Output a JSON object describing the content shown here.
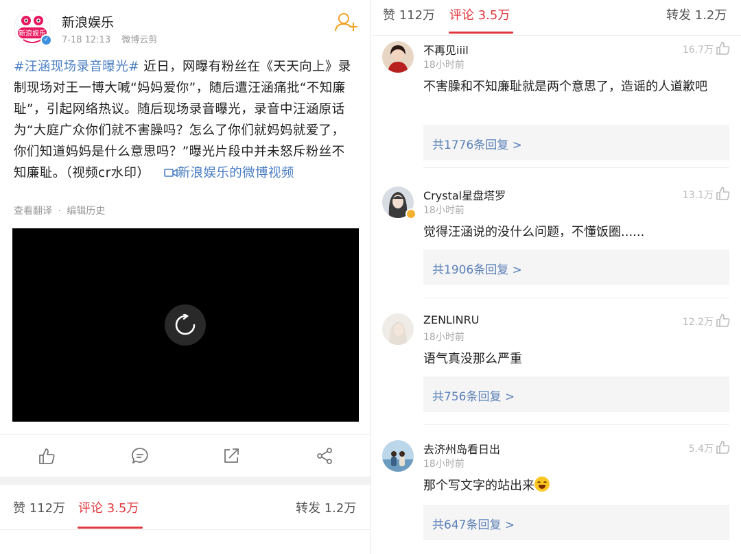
{
  "post": {
    "author": "新浪娱乐",
    "time": "7-18 12:13",
    "source": "微博云剪",
    "hashtag": "#汪涵现场录音曝光#",
    "body": " 近日，网曝有粉丝在《天天向上》录制现场对王一博大喊“妈妈爱你”，随后遭汪涵痛批“不知廉耻”，引起网络热议。随后现场录音曝光，录音中汪涵原话为“大庭广众你们就不害臊吗？怎么了你们就妈妈就爱了，你们知道妈妈是什么意思吗？”曝光片段中并未怒斥粉丝不知廉耻。（视频cr水印）",
    "video_link": "新浪娱乐的微博视频",
    "translate_label": "查看翻译",
    "dot": "·",
    "history_label": "编辑历史",
    "avatar_text": "新浪娱乐",
    "icons": [
      "follow-icon",
      "verified-icon",
      "loading-icon",
      "like-icon",
      "comment-icon",
      "repost-icon",
      "share-icon",
      "video-icon"
    ]
  },
  "stats": {
    "likes": "赞 112万",
    "comments": "评论 3.5万",
    "reposts": "转发 1.2万",
    "active_color": "#e0383e"
  },
  "comments": [
    {
      "name": "不再见iiil",
      "time": "18小时前",
      "likes": "16.7万",
      "text": "不害臊和不知廉耻就是两个意思了，造谣的人道歉吧",
      "replies": "共1776条回复 >"
    },
    {
      "name": "Crystal星盘塔罗",
      "time": "18小时前",
      "likes": "13.1万",
      "text": "觉得汪涵说的没什么问题，不懂饭圈......",
      "replies": "共1906条回复 >"
    },
    {
      "name": "ZENLINRU",
      "time": "18小时前",
      "likes": "12.2万",
      "text": "语气真没那么严重",
      "replies": "共756条回复 >"
    },
    {
      "name": "去济州岛看日出",
      "time": "18小时前",
      "likes": "5.4万",
      "text": "那个写文字的站出来",
      "replies": "共647条回复 >"
    }
  ]
}
